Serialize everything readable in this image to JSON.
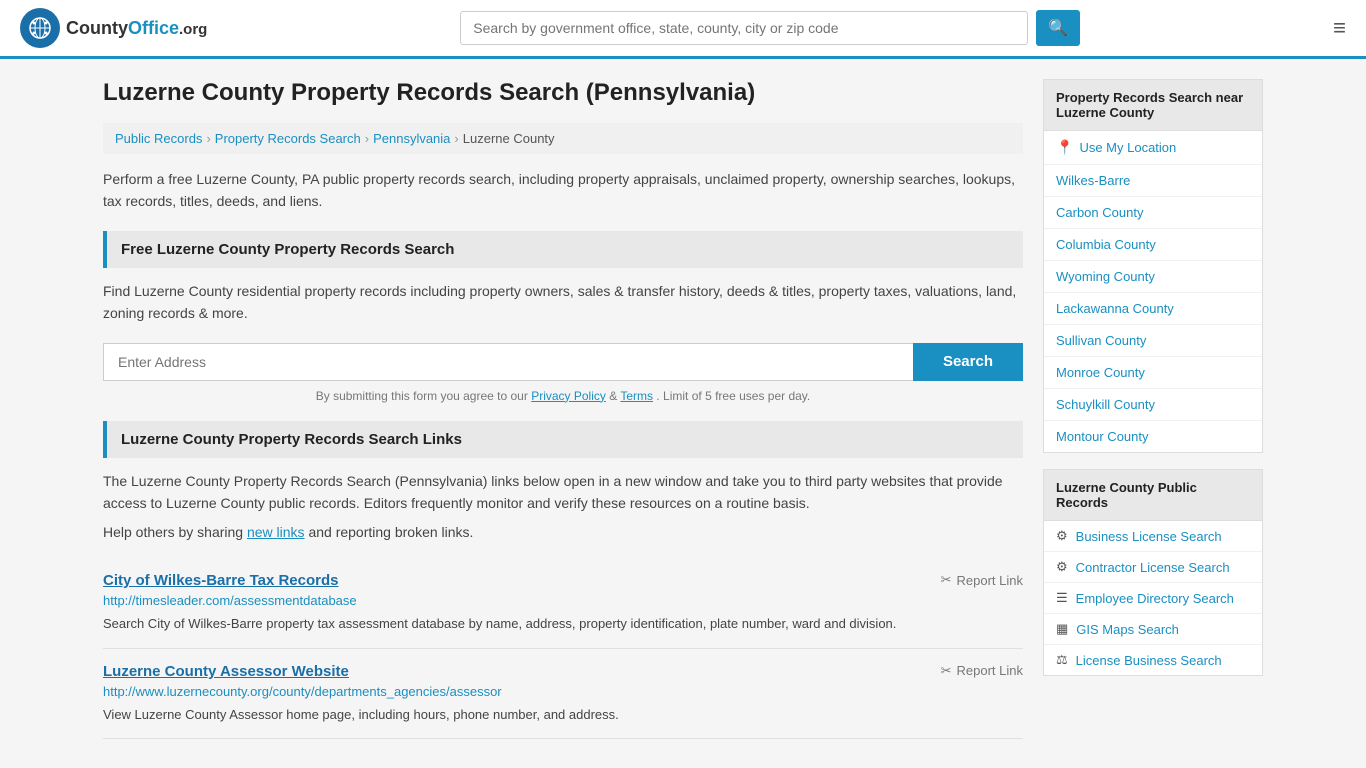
{
  "header": {
    "logo_text": "CountyOffice",
    "logo_suffix": ".org",
    "search_placeholder": "Search by government office, state, county, city or zip code",
    "search_value": ""
  },
  "page": {
    "title": "Luzerne County Property Records Search (Pennsylvania)",
    "description": "Perform a free Luzerne County, PA public property records search, including property appraisals, unclaimed property, ownership searches, lookups, tax records, titles, deeds, and liens."
  },
  "breadcrumb": {
    "items": [
      "Public Records",
      "Property Records Search",
      "Pennsylvania",
      "Luzerne County"
    ]
  },
  "free_search": {
    "heading": "Free Luzerne County Property Records Search",
    "description": "Find Luzerne County residential property records including property owners, sales & transfer history, deeds & titles, property taxes, valuations, land, zoning records & more.",
    "input_placeholder": "Enter Address",
    "search_button": "Search",
    "note_prefix": "By submitting this form you agree to our",
    "privacy_policy": "Privacy Policy",
    "and": "&",
    "terms": "Terms",
    "note_suffix": ". Limit of 5 free uses per day."
  },
  "links_section": {
    "heading": "Luzerne County Property Records Search Links",
    "description": "The Luzerne County Property Records Search (Pennsylvania) links below open in a new window and take you to third party websites that provide access to Luzerne County public records. Editors frequently monitor and verify these resources on a routine basis.",
    "share_text": "Help others by sharing",
    "share_link_text": "new links",
    "share_suffix": "and reporting broken links.",
    "records": [
      {
        "title": "City of Wilkes-Barre Tax Records",
        "url": "http://timesleader.com/assessmentdatabase",
        "description": "Search City of Wilkes-Barre property tax assessment database by name, address, property identification, plate number, ward and division.",
        "report_label": "Report Link"
      },
      {
        "title": "Luzerne County Assessor Website",
        "url": "http://www.luzernecounty.org/county/departments_agencies/assessor",
        "description": "View Luzerne County Assessor home page, including hours, phone number, and address.",
        "report_label": "Report Link"
      }
    ]
  },
  "sidebar": {
    "nearby_section": {
      "heading": "Property Records Search near Luzerne County",
      "use_my_location": "Use My Location",
      "items": [
        "Wilkes-Barre",
        "Carbon County",
        "Columbia County",
        "Wyoming County",
        "Lackawanna County",
        "Sullivan County",
        "Monroe County",
        "Schuylkill County",
        "Montour County"
      ]
    },
    "public_records_section": {
      "heading": "Luzerne County Public Records",
      "items": [
        {
          "icon": "⚙",
          "label": "Business License Search"
        },
        {
          "icon": "⚙",
          "label": "Contractor License Search"
        },
        {
          "icon": "☰",
          "label": "Employee Directory Search"
        },
        {
          "icon": "▦",
          "label": "GIS Maps Search"
        },
        {
          "icon": "⚖",
          "label": "License Business Search"
        }
      ]
    }
  }
}
